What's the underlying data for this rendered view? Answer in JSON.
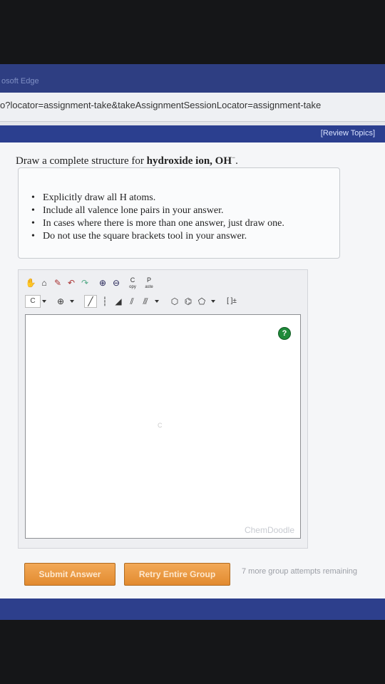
{
  "browser": {
    "title": "osoft Edge",
    "url": "o?locator=assignment-take&takeAssignmentSessionLocator=assignment-take"
  },
  "nav": {
    "review_topics": "[Review Topics]"
  },
  "question": {
    "prefix": "Draw a complete structure for ",
    "bold": "hydroxide ion, OH",
    "charge": "−",
    "suffix": "."
  },
  "instructions": [
    "Explicitly draw all H atoms.",
    "Include all valence lone pairs in your answer.",
    "In cases where there is more than one answer, just draw one.",
    "Do not use the square brackets tool in your answer."
  ],
  "editor": {
    "toolbar_row1": [
      {
        "name": "hand-icon",
        "glyph": "✋"
      },
      {
        "name": "lasso-icon",
        "glyph": "⌂"
      },
      {
        "name": "eraser-icon",
        "glyph": "✎"
      },
      {
        "name": "undo-icon",
        "glyph": "↶"
      },
      {
        "name": "redo-icon",
        "glyph": "↷"
      },
      {
        "name": "zoom-in-icon",
        "glyph": "⊕"
      },
      {
        "name": "zoom-out-icon",
        "glyph": "⊖"
      }
    ],
    "copy_label": "C",
    "copy_sub": "opy",
    "paste_label": "P",
    "paste_sub": "aste",
    "element_selector": "C",
    "charge_tool": "⊕",
    "bond_tools": [
      {
        "name": "single-bond-icon",
        "glyph": "╱"
      },
      {
        "name": "dashed-bond-icon",
        "glyph": "┆"
      },
      {
        "name": "wedge-bond-icon",
        "glyph": "◢"
      },
      {
        "name": "double-bond-icon",
        "glyph": "⫽"
      },
      {
        "name": "triple-bond-icon",
        "glyph": "⫻"
      }
    ],
    "ring_tools": [
      {
        "name": "cyclohexane-icon",
        "glyph": "⬡"
      },
      {
        "name": "benzene-icon",
        "glyph": "⌬"
      },
      {
        "name": "cyclopentane-icon",
        "glyph": "⬠"
      }
    ],
    "bracket_tool": "[ ]±",
    "help": "?",
    "canvas_mark": "C",
    "watermark": "ChemDoodle"
  },
  "actions": {
    "submit_label": "Submit Answer",
    "retry_label": "Retry Entire Group",
    "remaining_text": "7 more group attempts remaining"
  },
  "colors": {
    "title_bar": "#2e3e82",
    "accent_button": "#e9973f",
    "help_green": "#1f8a3a"
  }
}
